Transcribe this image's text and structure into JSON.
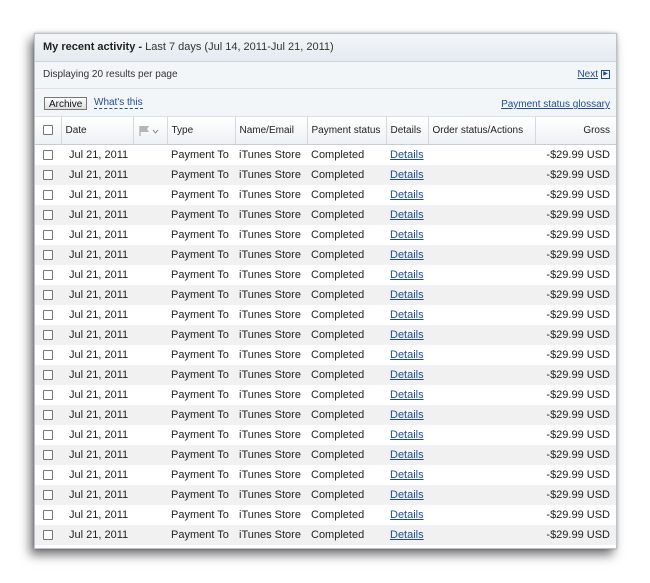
{
  "header": {
    "title_bold": "My recent activity -",
    "title_range": "Last 7 days (Jul 14, 2011-Jul 21, 2011)"
  },
  "info": {
    "results_text": "Displaying 20 results per page",
    "next_label": "Next"
  },
  "actions": {
    "archive_label": "Archive",
    "whats_this_label": "What's this",
    "glossary_label": "Payment status glossary"
  },
  "table": {
    "columns": [
      "Date",
      "Type",
      "Name/Email",
      "Payment status",
      "Details",
      "Order status/Actions",
      "Gross"
    ],
    "rows": [
      {
        "date": "Jul 21, 2011",
        "type": "Payment To",
        "name": "iTunes Store",
        "status": "Completed",
        "details": "Details",
        "order": "",
        "gross": "-$29.99 USD"
      },
      {
        "date": "Jul 21, 2011",
        "type": "Payment To",
        "name": "iTunes Store",
        "status": "Completed",
        "details": "Details",
        "order": "",
        "gross": "-$29.99 USD"
      },
      {
        "date": "Jul 21, 2011",
        "type": "Payment To",
        "name": "iTunes Store",
        "status": "Completed",
        "details": "Details",
        "order": "",
        "gross": "-$29.99 USD"
      },
      {
        "date": "Jul 21, 2011",
        "type": "Payment To",
        "name": "iTunes Store",
        "status": "Completed",
        "details": "Details",
        "order": "",
        "gross": "-$29.99 USD"
      },
      {
        "date": "Jul 21, 2011",
        "type": "Payment To",
        "name": "iTunes Store",
        "status": "Completed",
        "details": "Details",
        "order": "",
        "gross": "-$29.99 USD"
      },
      {
        "date": "Jul 21, 2011",
        "type": "Payment To",
        "name": "iTunes Store",
        "status": "Completed",
        "details": "Details",
        "order": "",
        "gross": "-$29.99 USD"
      },
      {
        "date": "Jul 21, 2011",
        "type": "Payment To",
        "name": "iTunes Store",
        "status": "Completed",
        "details": "Details",
        "order": "",
        "gross": "-$29.99 USD"
      },
      {
        "date": "Jul 21, 2011",
        "type": "Payment To",
        "name": "iTunes Store",
        "status": "Completed",
        "details": "Details",
        "order": "",
        "gross": "-$29.99 USD"
      },
      {
        "date": "Jul 21, 2011",
        "type": "Payment To",
        "name": "iTunes Store",
        "status": "Completed",
        "details": "Details",
        "order": "",
        "gross": "-$29.99 USD"
      },
      {
        "date": "Jul 21, 2011",
        "type": "Payment To",
        "name": "iTunes Store",
        "status": "Completed",
        "details": "Details",
        "order": "",
        "gross": "-$29.99 USD"
      },
      {
        "date": "Jul 21, 2011",
        "type": "Payment To",
        "name": "iTunes Store",
        "status": "Completed",
        "details": "Details",
        "order": "",
        "gross": "-$29.99 USD"
      },
      {
        "date": "Jul 21, 2011",
        "type": "Payment To",
        "name": "iTunes Store",
        "status": "Completed",
        "details": "Details",
        "order": "",
        "gross": "-$29.99 USD"
      },
      {
        "date": "Jul 21, 2011",
        "type": "Payment To",
        "name": "iTunes Store",
        "status": "Completed",
        "details": "Details",
        "order": "",
        "gross": "-$29.99 USD"
      },
      {
        "date": "Jul 21, 2011",
        "type": "Payment To",
        "name": "iTunes Store",
        "status": "Completed",
        "details": "Details",
        "order": "",
        "gross": "-$29.99 USD"
      },
      {
        "date": "Jul 21, 2011",
        "type": "Payment To",
        "name": "iTunes Store",
        "status": "Completed",
        "details": "Details",
        "order": "",
        "gross": "-$29.99 USD"
      },
      {
        "date": "Jul 21, 2011",
        "type": "Payment To",
        "name": "iTunes Store",
        "status": "Completed",
        "details": "Details",
        "order": "",
        "gross": "-$29.99 USD"
      },
      {
        "date": "Jul 21, 2011",
        "type": "Payment To",
        "name": "iTunes Store",
        "status": "Completed",
        "details": "Details",
        "order": "",
        "gross": "-$29.99 USD"
      },
      {
        "date": "Jul 21, 2011",
        "type": "Payment To",
        "name": "iTunes Store",
        "status": "Completed",
        "details": "Details",
        "order": "",
        "gross": "-$29.99 USD"
      },
      {
        "date": "Jul 21, 2011",
        "type": "Payment To",
        "name": "iTunes Store",
        "status": "Completed",
        "details": "Details",
        "order": "",
        "gross": "-$29.99 USD"
      },
      {
        "date": "Jul 21, 2011",
        "type": "Payment To",
        "name": "iTunes Store",
        "status": "Completed",
        "details": "Details",
        "order": "",
        "gross": "-$29.99 USD"
      }
    ]
  },
  "icons": {
    "flag_column": "flag-icon",
    "next": "next-page-icon"
  },
  "colors": {
    "link": "#1f4d92",
    "row_stripe": "#f1f1f1",
    "header_bg": "#e4eaf0"
  }
}
